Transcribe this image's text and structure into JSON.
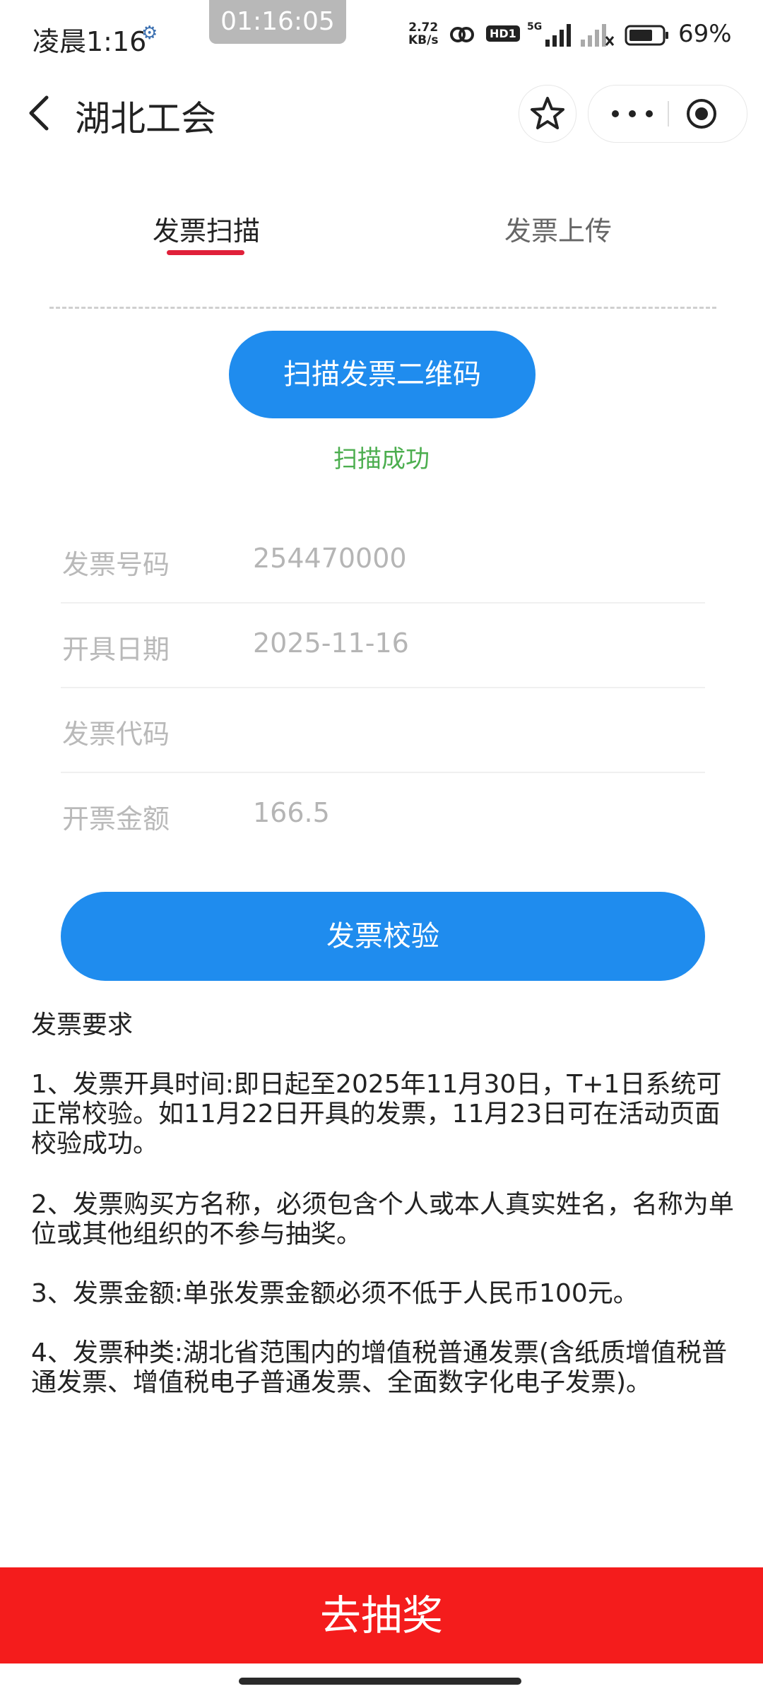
{
  "status_bar": {
    "time": "凌晨1:16",
    "recording_time": "01:16:05",
    "net_speed_value": "2.72",
    "net_speed_unit": "KB/s",
    "hd_badge": "HD1",
    "network": "5G",
    "battery": "69%",
    "icons": [
      "gear-icon",
      "ring-icon",
      "signal-icon",
      "battery-icon"
    ]
  },
  "header": {
    "title": "湖北工会",
    "icons": [
      "back-icon",
      "star-icon",
      "more-icon",
      "target-icon"
    ]
  },
  "tabs": [
    {
      "label": "发票扫描",
      "active": true
    },
    {
      "label": "发票上传",
      "active": false
    }
  ],
  "scan": {
    "button_label": "扫描发票二维码",
    "status": "扫描成功"
  },
  "fields": [
    {
      "label": "发票号码",
      "value": "254470000"
    },
    {
      "label": "开具日期",
      "value": "2025-11-16"
    },
    {
      "label": "发票代码",
      "value": ""
    },
    {
      "label": "开票金额",
      "value": "166.5"
    }
  ],
  "verify_button": "发票校验",
  "requirements": {
    "title": "发票要求",
    "items": [
      "1、发票开具时间:即日起至2025年11月30日，T+1日系统可正常校验。如11月22日开具的发票，11月23日可在活动页面校验成功。",
      "2、发票购买方名称，必须包含个人或本人真实姓名，名称为单位或其他组织的不参与抽奖。",
      "3、发票金额:单张发票金额必须不低于人民币100元。",
      "4、发票种类:湖北省范围内的增值税普通发票(含纸质增值税普通发票、增值税电子普通发票、全面数字化电子发票)。"
    ]
  },
  "draw_button": "去抽奖",
  "colors": {
    "primary_blue": "#1f8cee",
    "tab_underline": "#e0203a",
    "success_green": "#4cae4f",
    "draw_red": "#f41c1c"
  }
}
